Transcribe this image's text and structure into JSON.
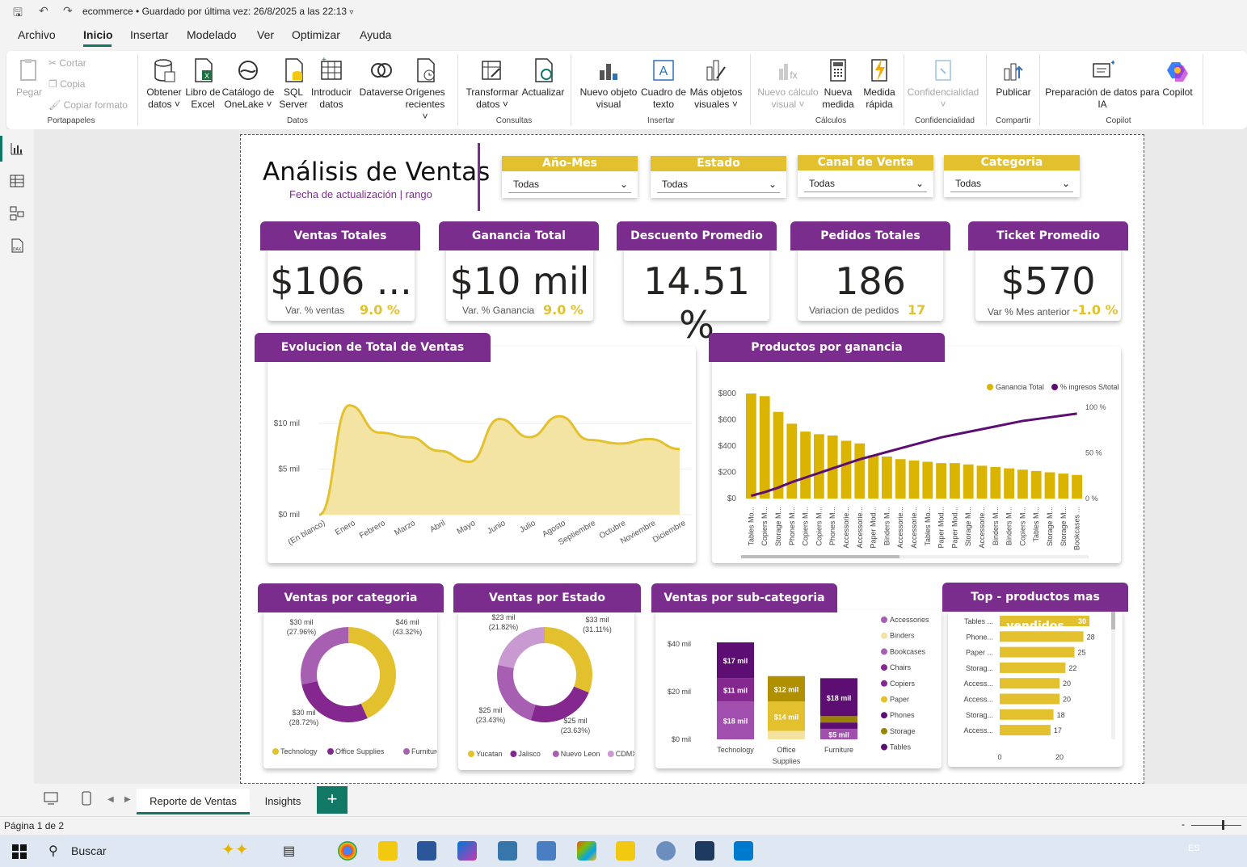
{
  "titlebar": {
    "file": "ecommerce",
    "saved": "Guardado por última vez: 26/8/2025 a las 22:13"
  },
  "menu": [
    "Archivo",
    "Inicio",
    "Insertar",
    "Modelado",
    "Ver",
    "Optimizar",
    "Ayuda"
  ],
  "ribbon": {
    "clipboard": {
      "paste": "Pegar",
      "cut": "Cortar",
      "copy": "Copia",
      "format": "Copiar formato",
      "group": "Portapapeles"
    },
    "data": {
      "get_data": "Obtener datos",
      "excel": "Libro de Excel",
      "onelake": "Catálogo de OneLake",
      "sql": "SQL Server",
      "enter": "Introducir datos",
      "dataverse": "Dataverse",
      "recent": "Orígenes recientes",
      "group": "Datos"
    },
    "queries": {
      "transform": "Transformar datos",
      "refresh": "Actualizar",
      "group": "Consultas"
    },
    "insert": {
      "visual": "Nuevo objeto visual",
      "textbox": "Cuadro de texto",
      "more": "Más objetos visuales",
      "group": "Insertar"
    },
    "calc": {
      "newcalc": "Nuevo cálculo visual",
      "measure": "Nueva medida",
      "quick": "Medida rápida",
      "group": "Cálculos"
    },
    "conf": {
      "label": "Confidencialidad",
      "group": "Confidencialidad"
    },
    "share": {
      "publish": "Publicar",
      "group": "Compartir"
    },
    "copilot": {
      "prep": "Preparación de datos para IA",
      "copilot": "Copilot",
      "group": "Copilot"
    }
  },
  "report": {
    "title": "Análisis de Ventas",
    "subtitle": "Fecha de actualización | rango",
    "slicers": [
      {
        "label": "Año-Mes",
        "value": "Todas"
      },
      {
        "label": "Estado",
        "value": "Todas"
      },
      {
        "label": "Canal de Venta",
        "value": "Todas"
      },
      {
        "label": "Categoria",
        "value": "Todas"
      }
    ],
    "kpis": [
      {
        "title": "Ventas Totales",
        "value": "$106 ...",
        "sub": "Var. % ventas",
        "var": "9.0 %"
      },
      {
        "title": "Ganancia Total",
        "value": "$10 mil",
        "sub": "Var. % Ganancia",
        "var": "9.0 %"
      },
      {
        "title": "Descuento Promedio",
        "value": "14.51 %",
        "sub": "",
        "var": ""
      },
      {
        "title": "Pedidos Totales",
        "value": "186",
        "sub": "Variacion de pedidos",
        "var": "17"
      },
      {
        "title": "Ticket Promedio",
        "value": "$570",
        "sub": "Var % Mes anterior",
        "var": "-1.0 %"
      }
    ],
    "visual_titles": {
      "area": "Evolucion de Total de Ventas",
      "pareto": "Productos por ganancia",
      "cat": "Ventas por categoria",
      "estado": "Ventas por Estado",
      "subcat": "Ventas por sub-categoria",
      "top": "Top  - productos mas vendidos"
    }
  },
  "chart_data": [
    {
      "type": "area",
      "title": "Evolucion de Total de Ventas",
      "categories": [
        "(En blanco)",
        "Enero",
        "Febrero",
        "Marzo",
        "Abril",
        "Mayo",
        "Junio",
        "Julio",
        "Agosto",
        "Septiembre",
        "Octubre",
        "Noviembre",
        "Diciembre"
      ],
      "values": [
        0,
        12,
        9,
        8.5,
        7,
        5.8,
        10.5,
        8.5,
        10.8,
        8.2,
        7.8,
        8.3,
        7.2
      ],
      "y_ticks": [
        "$0 mil",
        "$5 mil",
        "$10 mil"
      ],
      "ylim": [
        0,
        14
      ],
      "color": "#e3c12e"
    },
    {
      "type": "bar",
      "title": "Productos por ganancia",
      "categories": [
        "Tables Mo...",
        "Copiers M...",
        "Storage M...",
        "Phones M...",
        "Copiers M...",
        "Copiers M...",
        "Phones M...",
        "Accessorie...",
        "Accessorie...",
        "Paper Mod...",
        "Binders M...",
        "Accessorie...",
        "Accessorie...",
        "Tables Mo...",
        "Paper Mod...",
        "Paper Mod...",
        "Storage M...",
        "Accessorie...",
        "Binders M...",
        "Binders M...",
        "Copiers M...",
        "Tables M...",
        "Storage M...",
        "Storage M...",
        "Bookcases ..."
      ],
      "series": [
        {
          "name": "Ganancia Total",
          "values": [
            800,
            780,
            660,
            570,
            510,
            490,
            480,
            440,
            420,
            330,
            320,
            300,
            290,
            280,
            270,
            270,
            260,
            250,
            240,
            230,
            220,
            210,
            200,
            190,
            180
          ]
        },
        {
          "name": "% ingresos S/total",
          "values": [
            3,
            7,
            12,
            18,
            23,
            28,
            33,
            38,
            43,
            47,
            51,
            55,
            59,
            63,
            67,
            70,
            73,
            76,
            79,
            82,
            85,
            87,
            89,
            91,
            93
          ]
        }
      ],
      "y_ticks": [
        "$0",
        "$200",
        "$400",
        "$600",
        "$800"
      ],
      "y2_ticks": [
        "0 %",
        "50 %",
        "100 %"
      ],
      "legend": [
        "Ganancia Total",
        "% ingresos S/total"
      ],
      "colors": [
        "#dbb400",
        "#5c0e72"
      ]
    },
    {
      "type": "pie",
      "title": "Ventas por categoria",
      "series": [
        {
          "name": "Technology",
          "value": 46,
          "label": "$46 mil",
          "pct": "(43.32%)",
          "color": "#e3c12e"
        },
        {
          "name": "Office Supplies",
          "value": 30,
          "label": "$30 mil",
          "pct": "(28.72%)",
          "color": "#84288f"
        },
        {
          "name": "Furniture",
          "value": 30,
          "label": "$30 mil",
          "pct": "(27.96%)",
          "color": "#a75fb2"
        }
      ]
    },
    {
      "type": "pie",
      "title": "Ventas por Estado",
      "series": [
        {
          "name": "Yucatan",
          "value": 33,
          "label": "$33 mil",
          "pct": "(31.11%)",
          "color": "#e3c12e"
        },
        {
          "name": "Jalisco",
          "value": 25,
          "label": "$25 mil",
          "pct": "(23.63%)",
          "color": "#84288f"
        },
        {
          "name": "Nuevo Leon",
          "value": 25,
          "label": "$25 mil",
          "pct": "(23.43%)",
          "color": "#a75fb2"
        },
        {
          "name": "CDMX",
          "value": 23,
          "label": "$23 mil",
          "pct": "(21.82%)",
          "color": "#c99ad1"
        }
      ]
    },
    {
      "type": "bar",
      "title": "Ventas por sub-categoria",
      "categories": [
        "Technology",
        "Office Supplies",
        "Furniture"
      ],
      "y_ticks": [
        "$0 mil",
        "$20 mil",
        "$40 mil"
      ],
      "series": [
        {
          "name": "Technology",
          "segments": [
            {
              "value": 18,
              "label": "$18 mil",
              "color": "#a04fae"
            },
            {
              "value": 11,
              "label": "$11 mil",
              "color": "#84288f"
            },
            {
              "value": 17,
              "label": "$17 mil",
              "color": "#5c0e72"
            }
          ]
        },
        {
          "name": "Office Supplies",
          "segments": [
            {
              "value": 4,
              "label": "",
              "color": "#f4e3a0"
            },
            {
              "value": 14,
              "label": "$14 mil",
              "color": "#e3c12e"
            },
            {
              "value": 12,
              "label": "$12 mil",
              "color": "#b09000"
            }
          ]
        },
        {
          "name": "Furniture",
          "segments": [
            {
              "value": 5,
              "label": "$5 mil",
              "color": "#a04fae"
            },
            {
              "value": 3,
              "label": "",
              "color": "#5c0e72"
            },
            {
              "value": 3,
              "label": "",
              "color": "#9b8200"
            },
            {
              "value": 18,
              "label": "$18 mil",
              "color": "#5c0e72"
            }
          ]
        }
      ],
      "legend": [
        {
          "name": "Accessories",
          "color": "#a75fb2"
        },
        {
          "name": "Binders",
          "color": "#f2e3a5"
        },
        {
          "name": "Bookcases",
          "color": "#a75fb2"
        },
        {
          "name": "Chairs",
          "color": "#84288f"
        },
        {
          "name": "Copiers",
          "color": "#84288f"
        },
        {
          "name": "Paper",
          "color": "#e3c12e"
        },
        {
          "name": "Phones",
          "color": "#5c0e72"
        },
        {
          "name": "Storage",
          "color": "#9b8200"
        },
        {
          "name": "Tables",
          "color": "#5c0e72"
        }
      ]
    },
    {
      "type": "bar",
      "title": "Top  - productos mas vendidos",
      "categories": [
        "Tables ...",
        "Phone...",
        "Paper ...",
        "Storag...",
        "Access...",
        "Access...",
        "Storag...",
        "Access..."
      ],
      "values": [
        30,
        28,
        25,
        22,
        20,
        20,
        18,
        17
      ],
      "x_ticks": [
        "0",
        "20"
      ],
      "color": "#e3c12e"
    }
  ],
  "tabs": {
    "t1": "Reporte de Ventas",
    "t2": "Insights",
    "add": "+"
  },
  "status": {
    "page": "Página 1 de 2"
  },
  "taskbar": {
    "search": "Buscar",
    "lang": "ES"
  }
}
